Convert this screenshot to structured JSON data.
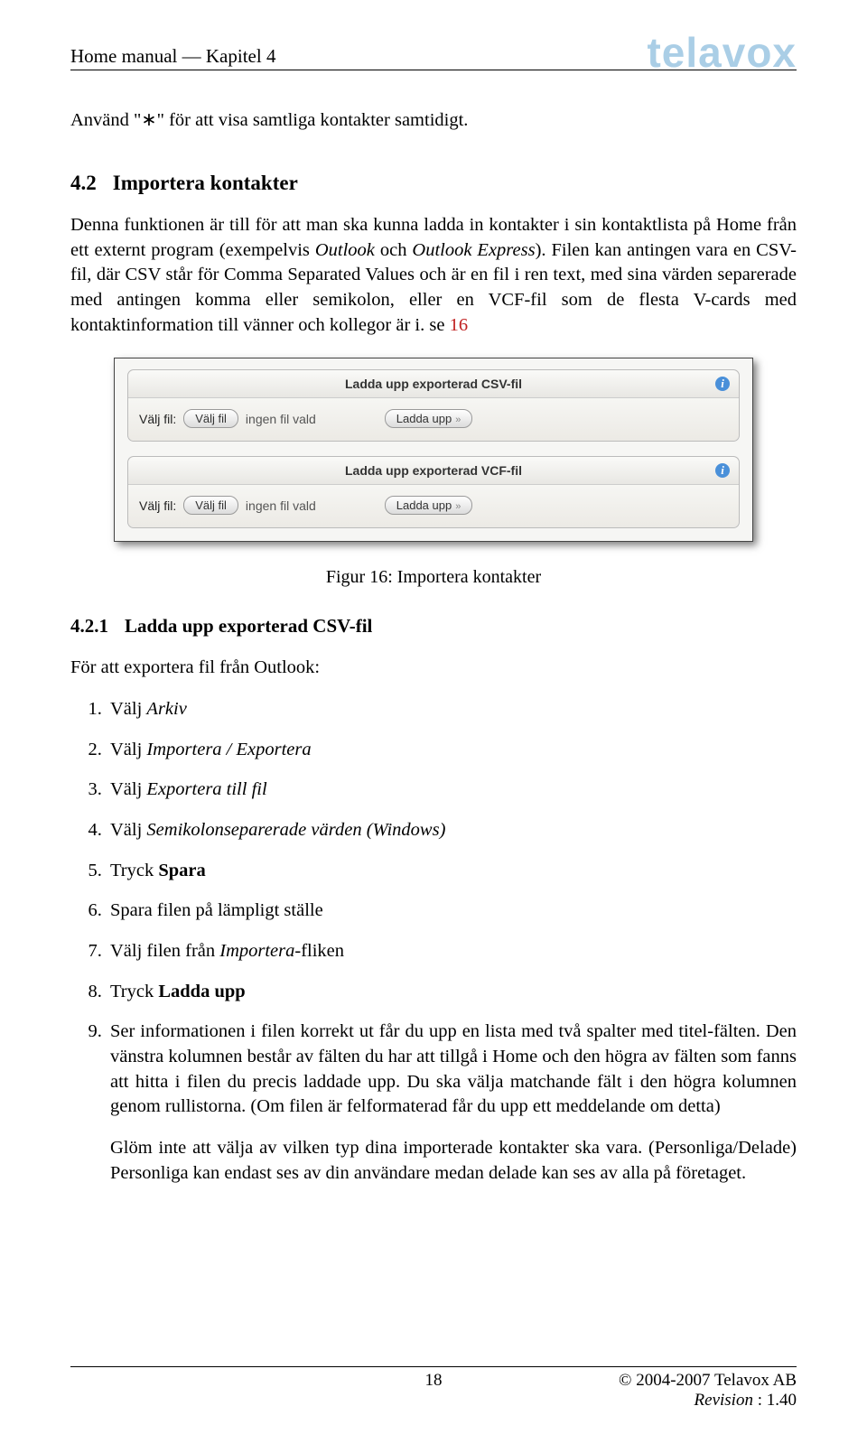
{
  "header": {
    "left": "Home manual — Kapitel 4",
    "logo": "telavox"
  },
  "intro_para": "Använd \"∗\" för att visa samtliga kontakter samtidigt.",
  "sec42": {
    "num": "4.2",
    "title": "Importera kontakter",
    "para1_a": "Denna funktionen är till för att man ska kunna ladda in kontakter i sin kontaktlista på Home från ett externt program (exempelvis ",
    "para1_i1": "Outlook",
    "para1_b": " och ",
    "para1_i2": "Outlook Express",
    "para1_c": "). Filen kan antingen vara en CSV-fil, där CSV står för Comma Separated Values och är en fil i ren text, med sina värden separerade med antingen komma eller semikolon, eller en VCF-fil som de flesta V-cards med kontaktinformation till vänner och kollegor är i. se ",
    "para1_ref": "16"
  },
  "dialog": {
    "panel1": {
      "title": "Ladda upp exporterad CSV-fil"
    },
    "panel2": {
      "title": "Ladda upp exporterad VCF-fil"
    },
    "common": {
      "label": "Välj fil:",
      "choose_btn": "Välj fil",
      "nofile": "ingen fil vald",
      "upload_btn": "Ladda upp"
    }
  },
  "caption": "Figur 16: Importera kontakter",
  "sec421": {
    "num": "4.2.1",
    "title": "Ladda upp exporterad CSV-fil",
    "lead": "För att exportera fil från Outlook:"
  },
  "steps": {
    "s1_a": "Välj ",
    "s1_i": "Arkiv",
    "s2_a": "Välj ",
    "s2_i": "Importera / Exportera",
    "s3_a": "Välj ",
    "s3_i": "Exportera till fil",
    "s4_a": "Välj ",
    "s4_i": "Semikolonseparerade värden (Windows)",
    "s5_a": "Tryck ",
    "s5_b": "Spara",
    "s6": "Spara filen på lämpligt ställe",
    "s7_a": "Välj filen från ",
    "s7_i": "Importera",
    "s7_b": "-fliken",
    "s8_a": "Tryck ",
    "s8_b": "Ladda upp",
    "s9": "Ser informationen i filen korrekt ut får du upp en lista med två spalter med titel-fälten. Den vänstra kolumnen består av fälten du har att tillgå i Home och den högra av fälten som fanns att hitta i filen du precis laddade upp. Du ska välja matchande fält i den högra kolumnen genom rullistorna. (Om filen är felformaterad får du upp ett meddelande om detta)",
    "s9_p2": "Glöm inte att välja av vilken typ dina importerade kontakter ska vara. (Personliga/Delade) Personliga kan endast ses av din användare medan delade kan ses av alla på företaget."
  },
  "footer": {
    "page": "18",
    "copyright": "© 2004-2007 Telavox AB",
    "rev_label": "Revision",
    "rev_sep": " : ",
    "rev_val": "1.40"
  }
}
